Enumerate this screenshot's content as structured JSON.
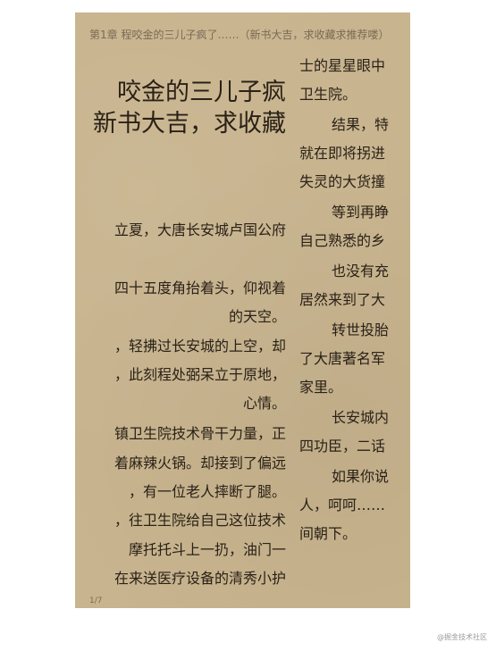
{
  "reader": {
    "chapter_header": "第1章 程咬金的三儿子疯了……（新书大吉，求收藏求推荐喽）",
    "page_indicator": "1/7",
    "left_column": {
      "title_lines": [
        "咬金的三儿子疯",
        "新书大吉，求收藏"
      ],
      "paragraph_lines": [
        "立夏，大唐长安城卢国公府",
        "四十五度角抬着头，仰视着",
        "的天空。",
        "，轻拂过长安城的上空，却",
        "，此刻程处弼呆立于原地，",
        "心情。",
        "镇卫生院技术骨干力量，正",
        "着麻辣火锅。却接到了偏远",
        "，有一位老人摔断了腿。",
        "，往卫生院给自己这位技术",
        "摩托托斗上一扔，油门一",
        "在来送医疗设备的清秀小护"
      ]
    },
    "right_column": {
      "lines": [
        {
          "text": "士的星星眼中",
          "indent": false
        },
        {
          "text": "卫生院。",
          "indent": false
        },
        {
          "text": "结果，特",
          "indent": true
        },
        {
          "text": "就在即将拐进",
          "indent": false
        },
        {
          "text": "失灵的大货撞",
          "indent": false
        },
        {
          "text": "等到再睁",
          "indent": true
        },
        {
          "text": "自己熟悉的乡",
          "indent": false
        },
        {
          "text": "也没有充",
          "indent": true
        },
        {
          "text": "居然来到了大",
          "indent": false
        },
        {
          "text": "转世投胎",
          "indent": true
        },
        {
          "text": "了大唐著名军",
          "indent": false
        },
        {
          "text": "家里。",
          "indent": false
        },
        {
          "text": "长安城内",
          "indent": true
        },
        {
          "text": "四功臣，二话",
          "indent": false
        },
        {
          "text": "如果你说",
          "indent": true
        },
        {
          "text": "人，呵呵……",
          "indent": false
        },
        {
          "text": "间朝下。",
          "indent": false
        }
      ]
    }
  },
  "watermark": "@掘金技术社区",
  "colors": {
    "page_background": "#c8b48e",
    "text": "#2a2117",
    "meta_text": "#7a6a55"
  }
}
